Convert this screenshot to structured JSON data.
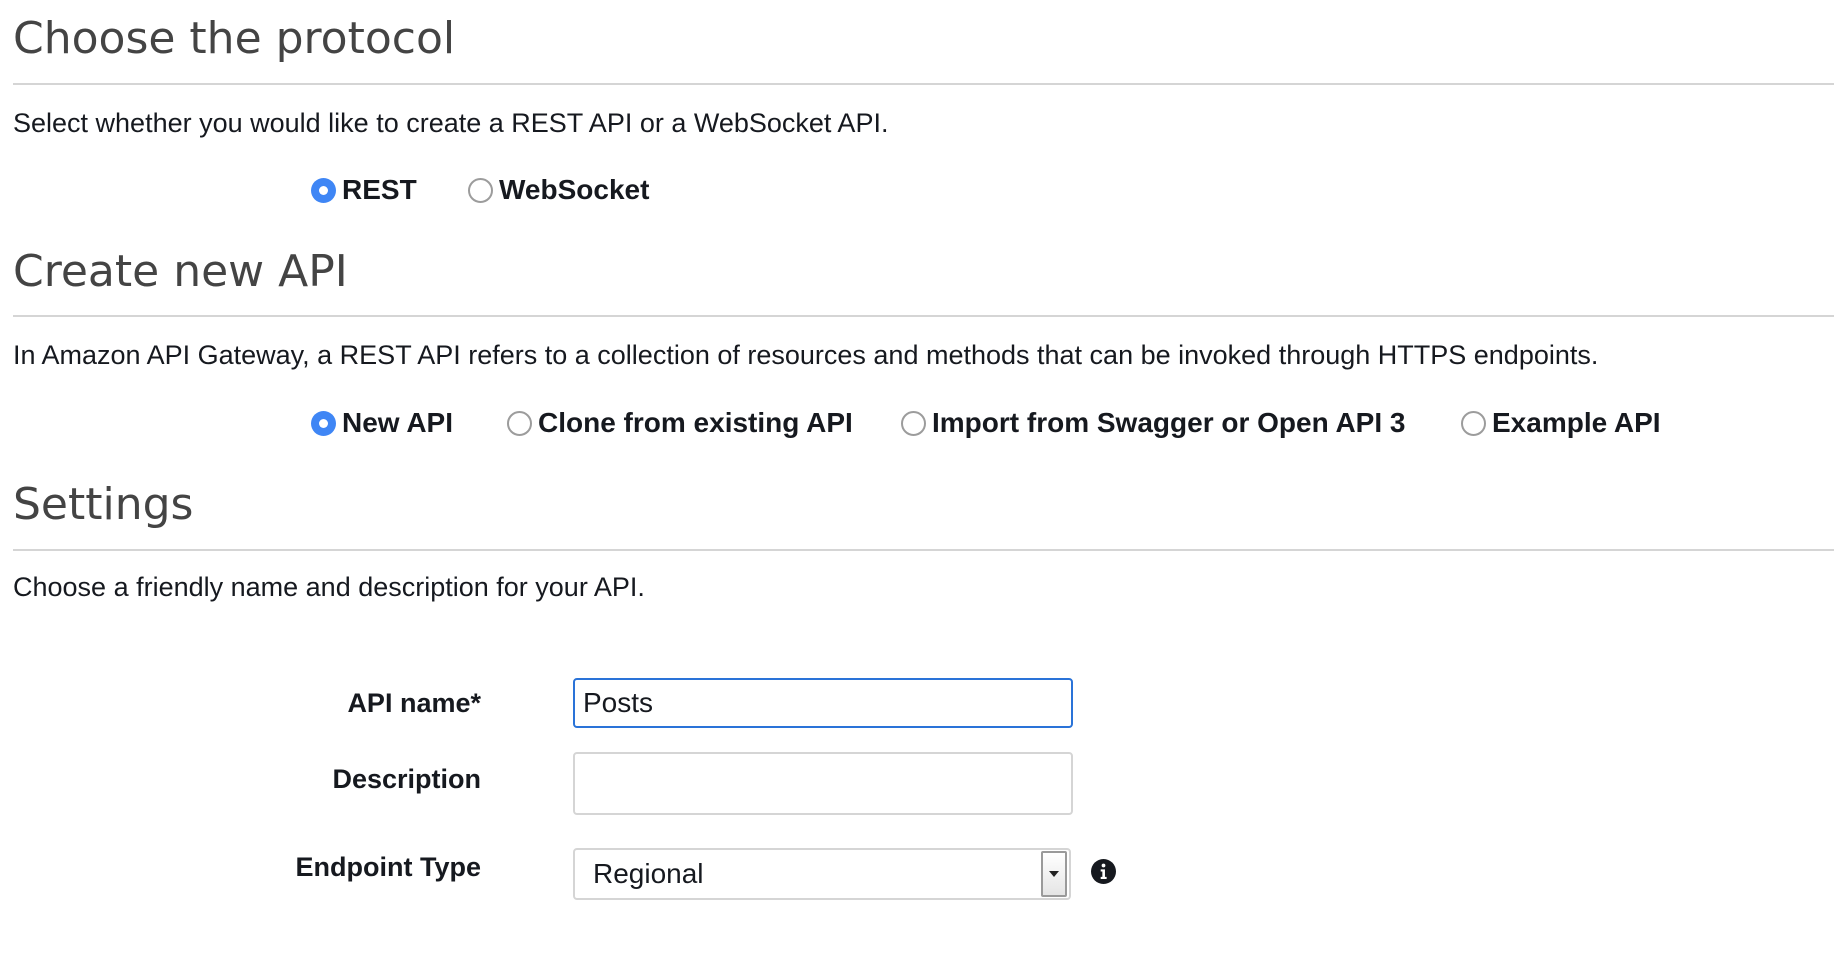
{
  "protocol": {
    "title": "Choose the protocol",
    "description": "Select whether you would like to create a REST API or a WebSocket API.",
    "options": [
      {
        "label": "REST",
        "selected": true
      },
      {
        "label": "WebSocket",
        "selected": false
      }
    ]
  },
  "create_api": {
    "title": "Create new API",
    "description": "In Amazon API Gateway, a REST API refers to a collection of resources and methods that can be invoked through HTTPS endpoints.",
    "options": [
      {
        "label": "New API",
        "selected": true
      },
      {
        "label": "Clone from existing API",
        "selected": false
      },
      {
        "label": "Import from Swagger or Open API 3",
        "selected": false
      },
      {
        "label": "Example API",
        "selected": false
      }
    ]
  },
  "settings": {
    "title": "Settings",
    "description": "Choose a friendly name and description for your API.",
    "api_name": {
      "label": "API name*",
      "value": "Posts"
    },
    "description_field": {
      "label": "Description",
      "value": ""
    },
    "endpoint_type": {
      "label": "Endpoint Type",
      "value": "Regional"
    }
  },
  "icons": {
    "selected_radio": "radio-selected-icon",
    "dropdown": "chevron-down-icon",
    "info": "info-icon"
  },
  "colors": {
    "accent": "#3f86f5",
    "heading": "#444444",
    "text": "#16191f",
    "focus_border": "#2a73d8"
  }
}
